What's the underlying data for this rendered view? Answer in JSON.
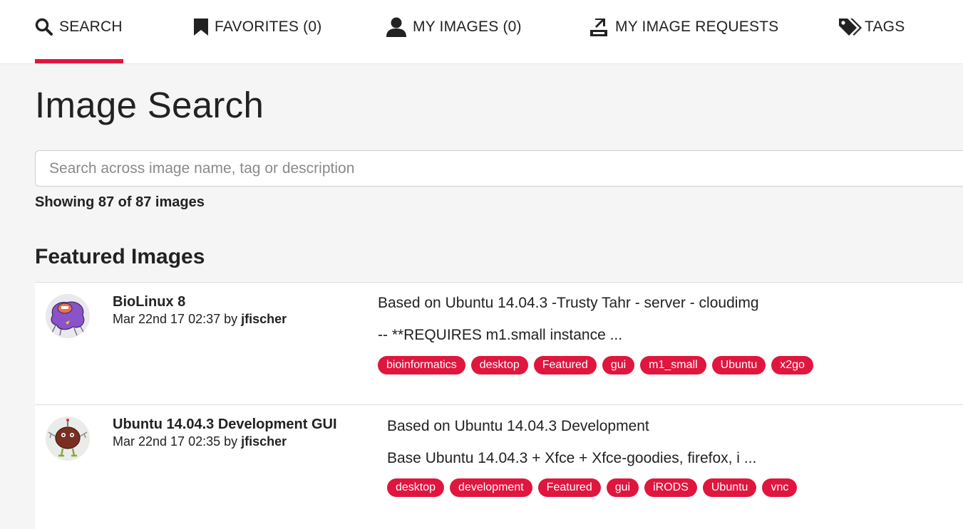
{
  "nav": {
    "tabs": [
      {
        "label": "SEARCH",
        "icon": "search-icon",
        "active": true
      },
      {
        "label": "FAVORITES (0)",
        "icon": "bookmark-icon",
        "active": false
      },
      {
        "label": "MY IMAGES (0)",
        "icon": "user-icon",
        "active": false
      },
      {
        "label": "MY IMAGE REQUESTS",
        "icon": "image-request-icon",
        "active": false
      },
      {
        "label": "TAGS",
        "icon": "tags-icon",
        "active": false
      }
    ],
    "accent_color": "#e0163f"
  },
  "page": {
    "title": "Image Search",
    "search_placeholder": "Search across image name, tag or description",
    "search_value": "",
    "result_count": "Showing 87 of 87 images",
    "section_title": "Featured Images"
  },
  "images": [
    {
      "name": "BioLinux 8",
      "date": "Mar 22nd 17 02:37 by",
      "author": "jfischer",
      "description_line1": "Based on Ubuntu 14.04.3 -Trusty Tahr - server - cloudimg",
      "description_line2": "-- **REQUIRES m1.small instance ...",
      "tags": [
        "bioinformatics",
        "desktop",
        "Featured",
        "gui",
        "m1_small",
        "Ubuntu",
        "x2go"
      ]
    },
    {
      "name": "Ubuntu 14.04.3 Development GUI",
      "date": "Mar 22nd 17 02:35 by",
      "author": "jfischer",
      "description_line1": "Based on Ubuntu 14.04.3 Development",
      "description_line2": "Base Ubuntu 14.04.3 + Xfce + Xfce-goodies, firefox, i ...",
      "tags": [
        "desktop",
        "development",
        "Featured",
        "gui",
        "iRODS",
        "Ubuntu",
        "vnc"
      ]
    }
  ]
}
